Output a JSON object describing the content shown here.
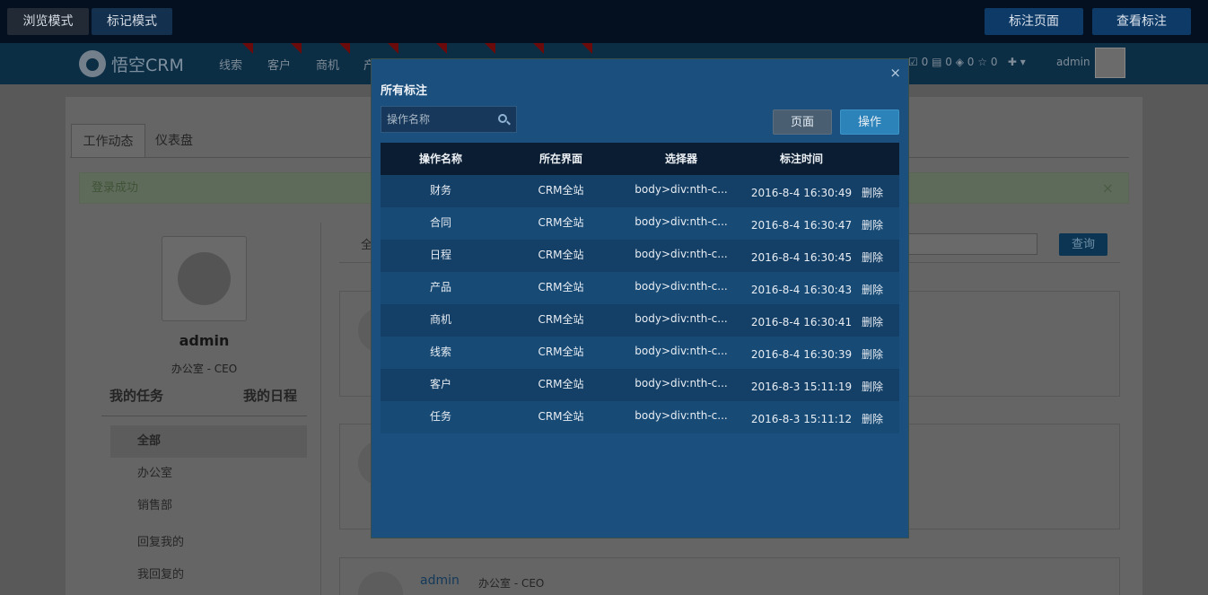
{
  "topbar": {
    "browse_mode": "浏览模式",
    "mark_mode": "标记模式",
    "mark_page": "标注页面",
    "view_marks": "查看标注"
  },
  "navbar": {
    "logo": "悟空CRM",
    "items": [
      "线索",
      "客户",
      "商机",
      "产"
    ],
    "stats": [
      "0",
      "0",
      "0",
      "0"
    ],
    "user": "admin"
  },
  "dashboard": {
    "tabs": [
      "工作动态",
      "仪表盘"
    ],
    "alert": "登录成功",
    "alert_close": "×",
    "profile": {
      "name": "admin",
      "dept": "办公室 - CEO"
    },
    "my_tasks": "我的任务",
    "my_schedule": "我的日程",
    "filters": [
      "全部",
      "办公室",
      "销售部",
      "回复我的",
      "我回复的"
    ],
    "feed_tab": "全",
    "query_button": "查询",
    "feed": {
      "name": "admin",
      "dept": "办公室 - CEO"
    }
  },
  "modal": {
    "title": "所有标注",
    "close": "×",
    "search_placeholder": "操作名称",
    "btn_page": "页面",
    "btn_operation": "操作",
    "columns": [
      "操作名称",
      "所在界面",
      "选择器",
      "标注时间",
      ""
    ],
    "rows": [
      {
        "name": "财务",
        "page": "CRM全站",
        "selector": "body>div:nth-c...",
        "time": "2016-8-4 16:30:49",
        "action": "删除"
      },
      {
        "name": "合同",
        "page": "CRM全站",
        "selector": "body>div:nth-c...",
        "time": "2016-8-4 16:30:47",
        "action": "删除"
      },
      {
        "name": "日程",
        "page": "CRM全站",
        "selector": "body>div:nth-c...",
        "time": "2016-8-4 16:30:45",
        "action": "删除"
      },
      {
        "name": "产品",
        "page": "CRM全站",
        "selector": "body>div:nth-c...",
        "time": "2016-8-4 16:30:43",
        "action": "删除"
      },
      {
        "name": "商机",
        "page": "CRM全站",
        "selector": "body>div:nth-c...",
        "time": "2016-8-4 16:30:41",
        "action": "删除"
      },
      {
        "name": "线索",
        "page": "CRM全站",
        "selector": "body>div:nth-c...",
        "time": "2016-8-4 16:30:39",
        "action": "删除"
      },
      {
        "name": "客户",
        "page": "CRM全站",
        "selector": "body>div:nth-c...",
        "time": "2016-8-3 15:11:19",
        "action": "删除"
      },
      {
        "name": "任务",
        "page": "CRM全站",
        "selector": "body>div:nth-c...",
        "time": "2016-8-3 15:11:12",
        "action": "删除"
      }
    ]
  }
}
